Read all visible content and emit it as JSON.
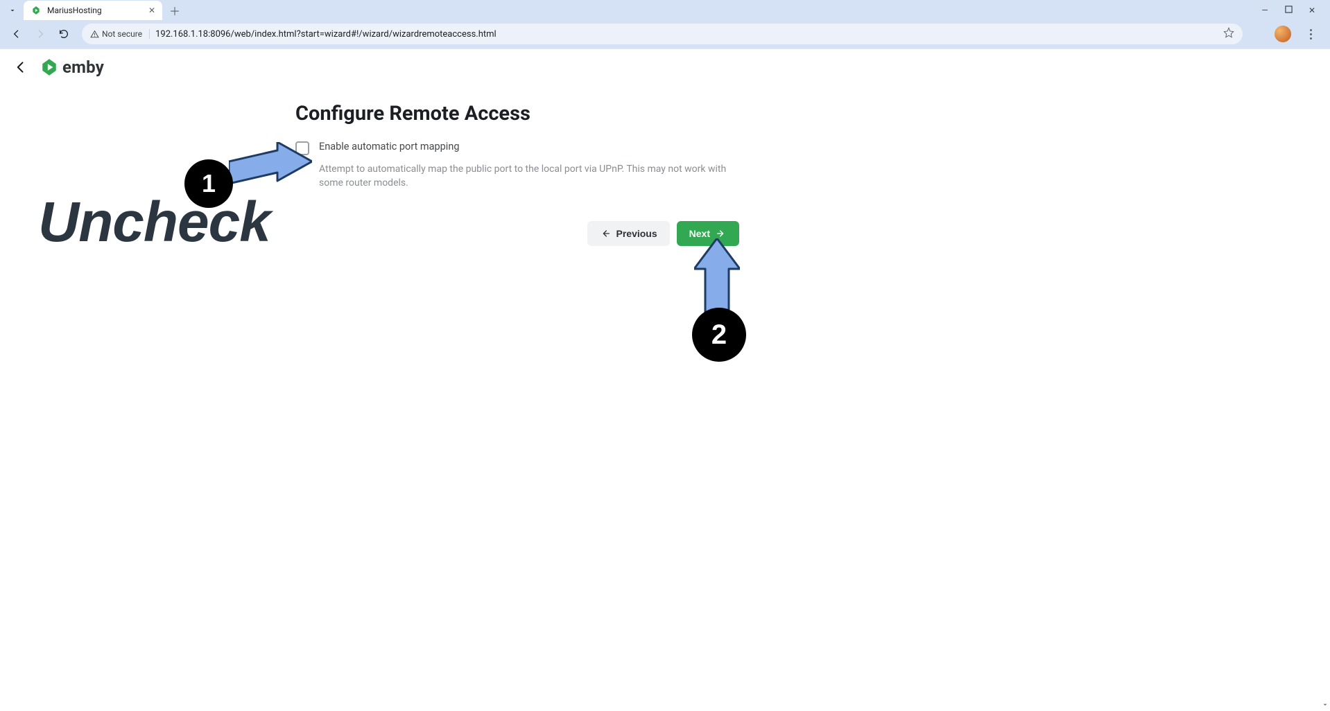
{
  "browser": {
    "tab_title": "MariusHosting",
    "url": "192.168.1.18:8096/web/index.html?start=wizard#!/wizard/wizardremoteaccess.html",
    "security_label": "Not secure"
  },
  "app": {
    "brand": "emby"
  },
  "wizard": {
    "title": "Configure Remote Access",
    "checkbox": {
      "label": "Enable automatic port mapping",
      "description": "Attempt to automatically map the public port to the local port via UPnP. This may not work with some router models."
    },
    "buttons": {
      "previous": "Previous",
      "next": "Next"
    }
  },
  "annotations": {
    "step1": "1",
    "step2": "2",
    "instruction": "Uncheck"
  },
  "colors": {
    "accent_green": "#33a852",
    "arrow_fill": "#86acea",
    "arrow_stroke": "#1e3c63"
  }
}
